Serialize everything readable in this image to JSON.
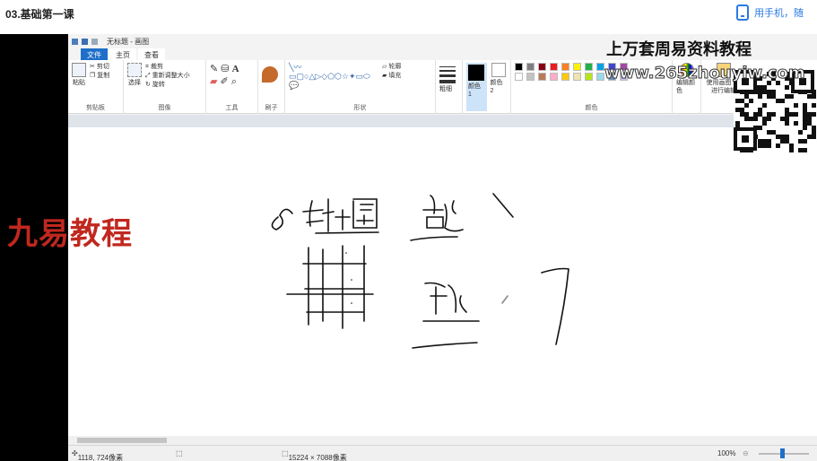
{
  "course": {
    "title": "03.基础第一课"
  },
  "phone_link": {
    "label": "用手机，随"
  },
  "paint": {
    "window_title": "无标题 - 画图",
    "tabs": [
      "文件",
      "主页",
      "查看"
    ],
    "clipboard": {
      "paste": "粘贴",
      "cut": "剪切",
      "copy": "复制",
      "label": "剪贴板"
    },
    "image": {
      "select": "选择",
      "crop": "裁剪",
      "resize": "重新调整大小",
      "rotate": "旋转",
      "label": "图像"
    },
    "tools": {
      "label": "工具"
    },
    "brushes": {
      "label": "刷子"
    },
    "shapes": {
      "outline": "轮廓",
      "fill": "填充",
      "label": "形状"
    },
    "size": {
      "label": "粗细"
    },
    "colors": {
      "color1": "颜色 1",
      "color2": "颜色 2",
      "edit": "编辑颜色",
      "label": "颜色",
      "paint3d": "使用画图 3D 进行编辑"
    },
    "status": {
      "cursor": "1118, 724像素",
      "size": "15224 × 7088像素",
      "zoom": "100%"
    }
  },
  "palette_colors": [
    "#000000",
    "#7f7f7f",
    "#880015",
    "#ed1c24",
    "#ff7f27",
    "#fff200",
    "#22b14c",
    "#00a2e8",
    "#3f48cc",
    "#a349a4",
    "#ffffff",
    "#c3c3c3",
    "#b97a57",
    "#ffaec9",
    "#ffc90e",
    "#efe4b0",
    "#b5e61d",
    "#99d9ea",
    "#7092be",
    "#c8bfe7"
  ],
  "watermarks": {
    "brand": "九易教程",
    "top": "上万套周易资料教程",
    "url": "www.265zhouyiw.com"
  },
  "handwriting": {
    "left_text": "8卦十图"
  }
}
